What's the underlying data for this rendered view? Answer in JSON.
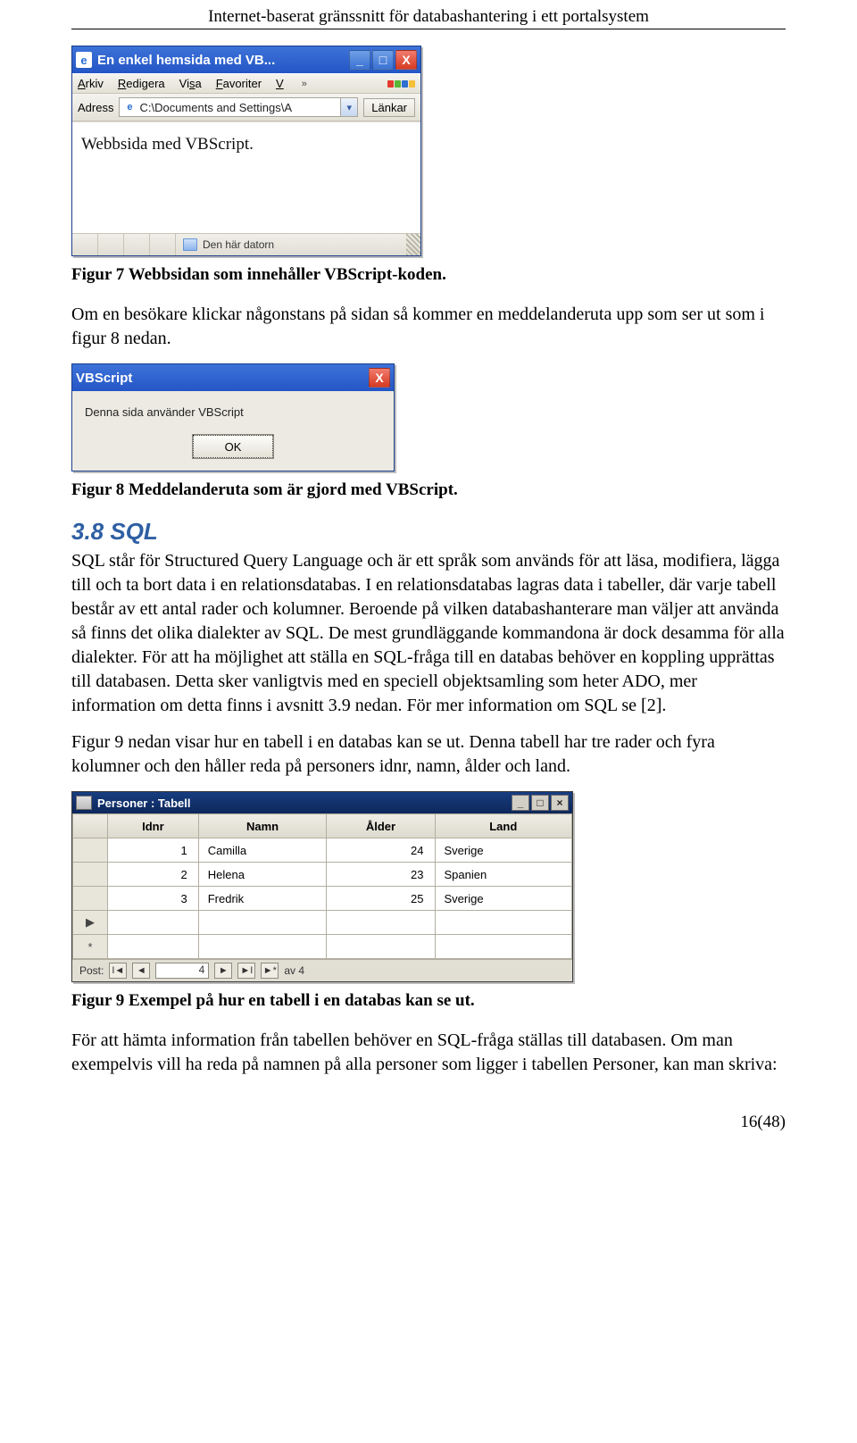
{
  "header": {
    "title": "Internet-baserat gränssnitt för databashantering i ett portalsystem"
  },
  "fig7": {
    "window_title": "En enkel hemsida med VB...",
    "minimize": "_",
    "maximize": "□",
    "close": "X",
    "menu": {
      "arkiv": "Arkiv",
      "redigera": "Redigera",
      "visa": "Visa",
      "favoriter": "Favoriter",
      "v": "V",
      "more": "»"
    },
    "address_label": "Adress",
    "address_value": "C:\\Documents and Settings\\A",
    "links_label": "Länkar",
    "page_text": "Webbsida med VBScript.",
    "status_text": "Den här datorn"
  },
  "caption7": "Figur 7 Webbsidan som innehåller VBScript-koden.",
  "para1": "Om en besökare klickar någonstans på sidan så kommer en meddelanderuta upp som ser ut som i figur 8 nedan.",
  "fig8": {
    "title": "VBScript",
    "close": "X",
    "message": "Denna sida använder VBScript",
    "ok": "OK"
  },
  "caption8": "Figur 8 Meddelanderuta som är gjord med VBScript.",
  "section": {
    "title": "3.8  SQL"
  },
  "para2": "SQL står för Structured Query Language och är ett språk som används för att läsa, modifiera, lägga till och ta bort data i en relationsdatabas. I en relationsdatabas lagras data i tabeller, där varje tabell består av ett antal rader och kolumner. Beroende på vilken databashanterare man väljer att använda så finns det olika dialekter av SQL. De mest grundläggande kommandona är dock desamma för alla dialekter. För att ha möjlighet att ställa en SQL-fråga till en databas behöver en koppling upprättas till databasen. Detta sker vanligtvis med en speciell objektsamling som heter ADO, mer information om detta finns i avsnitt 3.9 nedan. För mer information om SQL se [2].",
  "para3": "Figur 9 nedan visar hur en tabell i en databas kan se ut. Denna tabell har tre rader och fyra kolumner och den håller reda på personers idnr, namn, ålder och land.",
  "fig9": {
    "title": "Personer : Tabell",
    "minimize": "_",
    "maximize": "□",
    "close": "×",
    "columns": [
      "Idnr",
      "Namn",
      "Ålder",
      "Land"
    ],
    "rows": [
      {
        "idnr": "1",
        "namn": "Camilla",
        "alder": "24",
        "land": "Sverige"
      },
      {
        "idnr": "2",
        "namn": "Helena",
        "alder": "23",
        "land": "Spanien"
      },
      {
        "idnr": "3",
        "namn": "Fredrik",
        "alder": "25",
        "land": "Sverige"
      }
    ],
    "nav": {
      "label": "Post:",
      "first": "I◄",
      "prev": "◄",
      "pos": "4",
      "next": "►",
      "last": "►I",
      "new": "►*",
      "of_label": "av 4"
    }
  },
  "caption9": "Figur 9 Exempel på hur en tabell i en databas kan se ut.",
  "para4": "För att hämta information från tabellen behöver en SQL-fråga ställas till databasen. Om man exempelvis vill ha reda på namnen på alla personer som ligger i tabellen Personer, kan man skriva:",
  "page_number": "16(48)"
}
